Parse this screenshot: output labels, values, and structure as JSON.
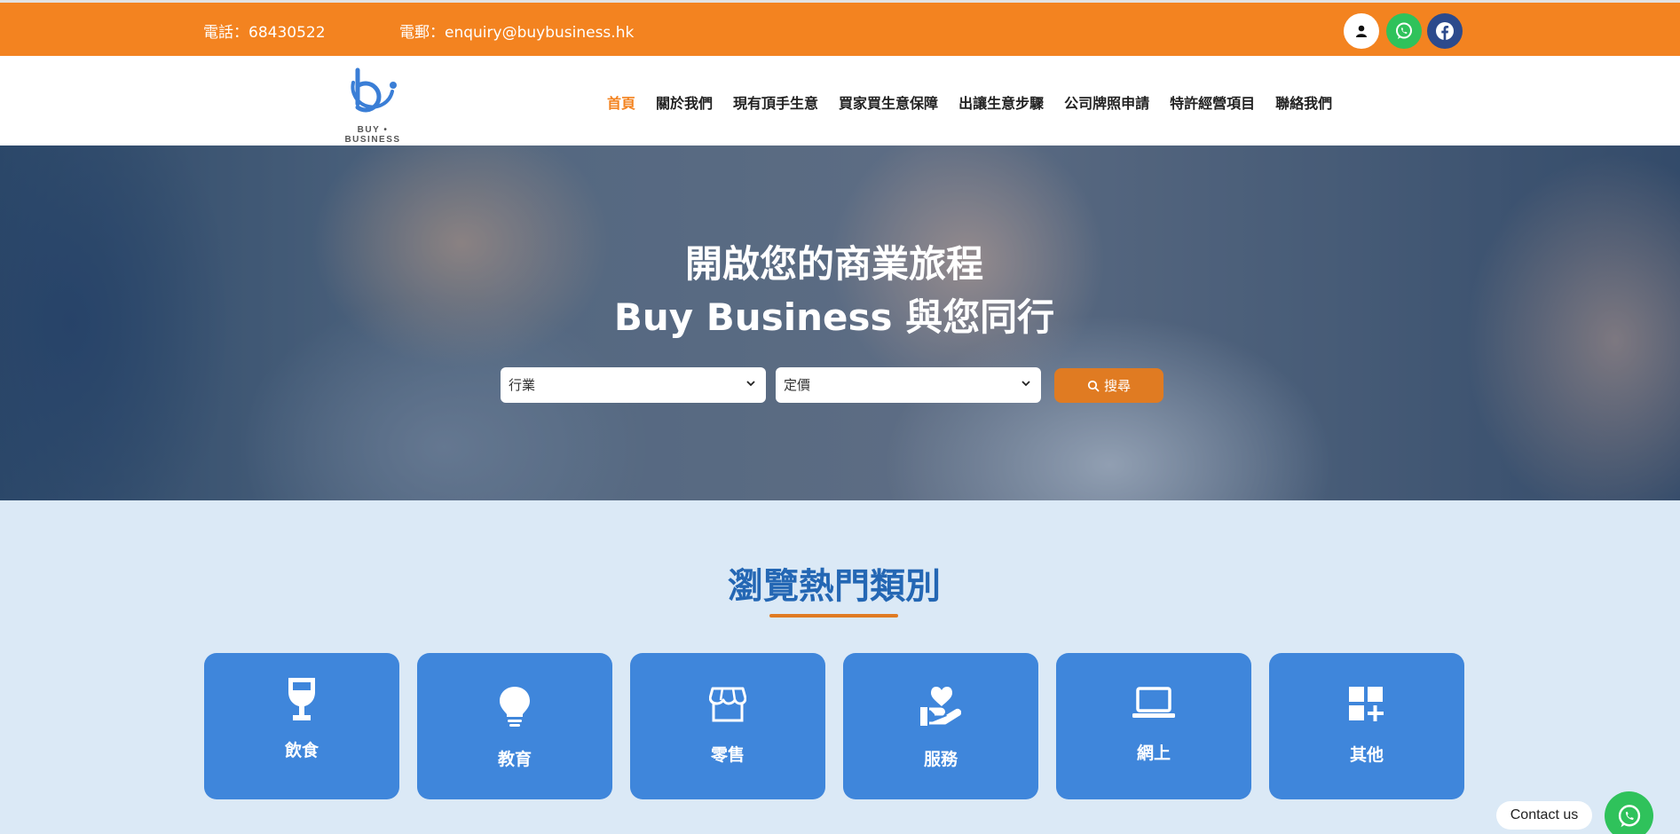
{
  "topbar": {
    "phone": "電話：68430522",
    "email": "電郵：enquiry@buybusiness.hk",
    "icons": [
      "user-icon",
      "whatsapp-icon",
      "facebook-icon"
    ]
  },
  "header": {
    "logo_text": "BUY • BUSINESS",
    "nav": [
      {
        "label": "首頁",
        "active": true
      },
      {
        "label": "關於我們"
      },
      {
        "label": "現有頂手生意"
      },
      {
        "label": "買家買生意保障"
      },
      {
        "label": "出讓生意步驟"
      },
      {
        "label": "公司牌照申請"
      },
      {
        "label": "特許經營項目"
      },
      {
        "label": "聯絡我們"
      }
    ]
  },
  "hero": {
    "title_line1": "開啟您的商業旅程",
    "title_line2": "Buy Business 與您同行",
    "industry_select": "行業",
    "price_select": "定價",
    "search_label": "搜尋"
  },
  "categories": {
    "title": "瀏覽熱門類別",
    "items": [
      {
        "label": "飲食",
        "icon": "wine-glass-icon"
      },
      {
        "label": "教育",
        "icon": "lightbulb-icon"
      },
      {
        "label": "零售",
        "icon": "store-icon"
      },
      {
        "label": "服務",
        "icon": "hand-heart-icon"
      },
      {
        "label": "網上",
        "icon": "laptop-icon"
      },
      {
        "label": "其他",
        "icon": "grid-plus-icon"
      }
    ]
  },
  "contact": {
    "label": "Contact us"
  },
  "colors": {
    "orange": "#f38320",
    "blue_card": "#3f86db",
    "title_blue": "#2467b4",
    "section_bg": "#dbe9f6"
  }
}
